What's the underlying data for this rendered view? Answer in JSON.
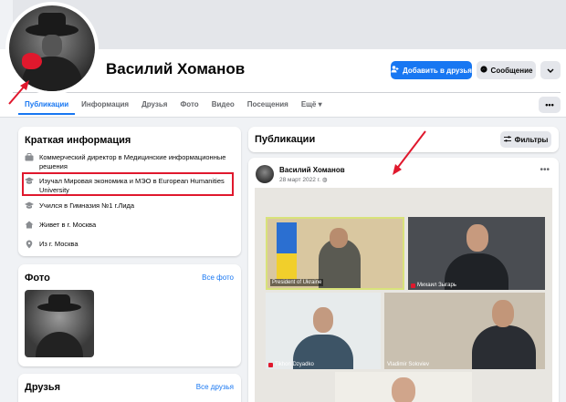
{
  "profile": {
    "name": "Василий Хоманов"
  },
  "actions": {
    "add_friend": "Добавить в друзья",
    "message": "Сообщение"
  },
  "tabs": [
    {
      "label": "Публикации",
      "active": true
    },
    {
      "label": "Информация"
    },
    {
      "label": "Друзья"
    },
    {
      "label": "Фото"
    },
    {
      "label": "Видео"
    },
    {
      "label": "Посещения"
    },
    {
      "label": "Ещё"
    }
  ],
  "intro": {
    "title": "Краткая информация",
    "items": [
      {
        "icon": "briefcase-icon",
        "text": "Коммерческий директор в Медицинские информационные решения"
      },
      {
        "icon": "graduation-cap-icon",
        "text": "Изучал Мировая экономика и МЭО в European Humanities University"
      },
      {
        "icon": "graduation-cap-icon",
        "text": "Учился в Гимназия №1 г.Лида"
      },
      {
        "icon": "home-icon",
        "text": "Живет в г. Москва"
      },
      {
        "icon": "location-pin-icon",
        "text": "Из г. Москва"
      }
    ]
  },
  "photos": {
    "title": "Фото",
    "link": "Все фото"
  },
  "friends": {
    "title": "Друзья",
    "link": "Все друзья"
  },
  "posts": {
    "title": "Публикации",
    "filters": "Фильтры"
  },
  "post": {
    "author": "Василий Хоманов",
    "date": "28 март 2022 г.",
    "video_tiles": [
      {
        "label": "President of Ukraine"
      },
      {
        "label": "Михаил Зыгарь"
      },
      {
        "label": "Tikhon Dzyadko"
      },
      {
        "label": "Vladimir Soloviev"
      }
    ]
  },
  "colors": {
    "accent": "#1877f2",
    "highlight": "#e0182d"
  }
}
